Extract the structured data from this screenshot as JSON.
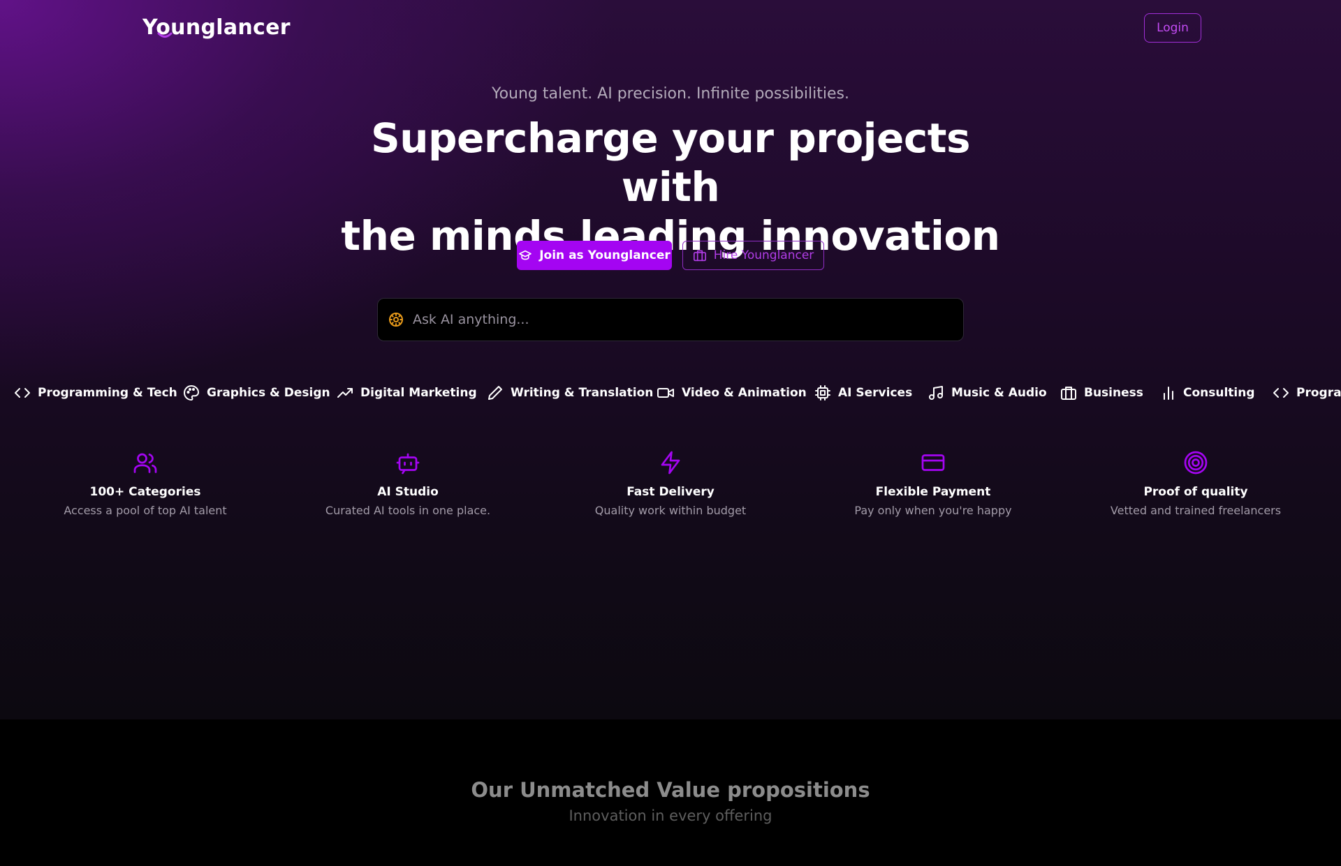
{
  "header": {
    "logo_text": "Younglancer",
    "login_label": "Login"
  },
  "hero": {
    "tagline": "Young talent. AI precision. Infinite possibilities.",
    "headline_line1": "Supercharge your projects with",
    "headline_line2": "the minds leading innovation",
    "join_label": "Join as Younglancer",
    "hire_label": "Hire Younglancer",
    "search_placeholder": "Ask AI anything..."
  },
  "categories": [
    {
      "label": "Programming & Tech",
      "icon": "code-icon"
    },
    {
      "label": "Graphics & Design",
      "icon": "palette-icon"
    },
    {
      "label": "Digital Marketing",
      "icon": "trending-up-icon"
    },
    {
      "label": "Writing & Translation",
      "icon": "pen-icon"
    },
    {
      "label": "Video & Animation",
      "icon": "video-icon"
    },
    {
      "label": "AI Services",
      "icon": "cpu-icon"
    },
    {
      "label": "Music & Audio",
      "icon": "music-icon"
    },
    {
      "label": "Business",
      "icon": "briefcase-icon"
    },
    {
      "label": "Consulting",
      "icon": "bar-chart-icon"
    },
    {
      "label": "Program",
      "icon": "code-icon"
    }
  ],
  "features": [
    {
      "title": "100+ Categories",
      "desc": "Access a pool of top AI talent",
      "icon": "users-icon"
    },
    {
      "title": "AI Studio",
      "desc": "Curated AI tools in one place.",
      "icon": "bot-icon"
    },
    {
      "title": "Fast Delivery",
      "desc": "Quality work within budget",
      "icon": "lightning-icon"
    },
    {
      "title": "Flexible Payment",
      "desc": "Pay only when you're happy",
      "icon": "credit-card-icon"
    },
    {
      "title": "Proof of quality",
      "desc": "Vetted and trained freelancers",
      "icon": "target-icon"
    }
  ],
  "value_section": {
    "title": "Our Unmatched Value propositions",
    "subtitle": "Innovation in every offering"
  },
  "colors": {
    "accent": "#a405f2",
    "accent_text": "#c44cf5",
    "search_icon": "#e89a1a"
  }
}
